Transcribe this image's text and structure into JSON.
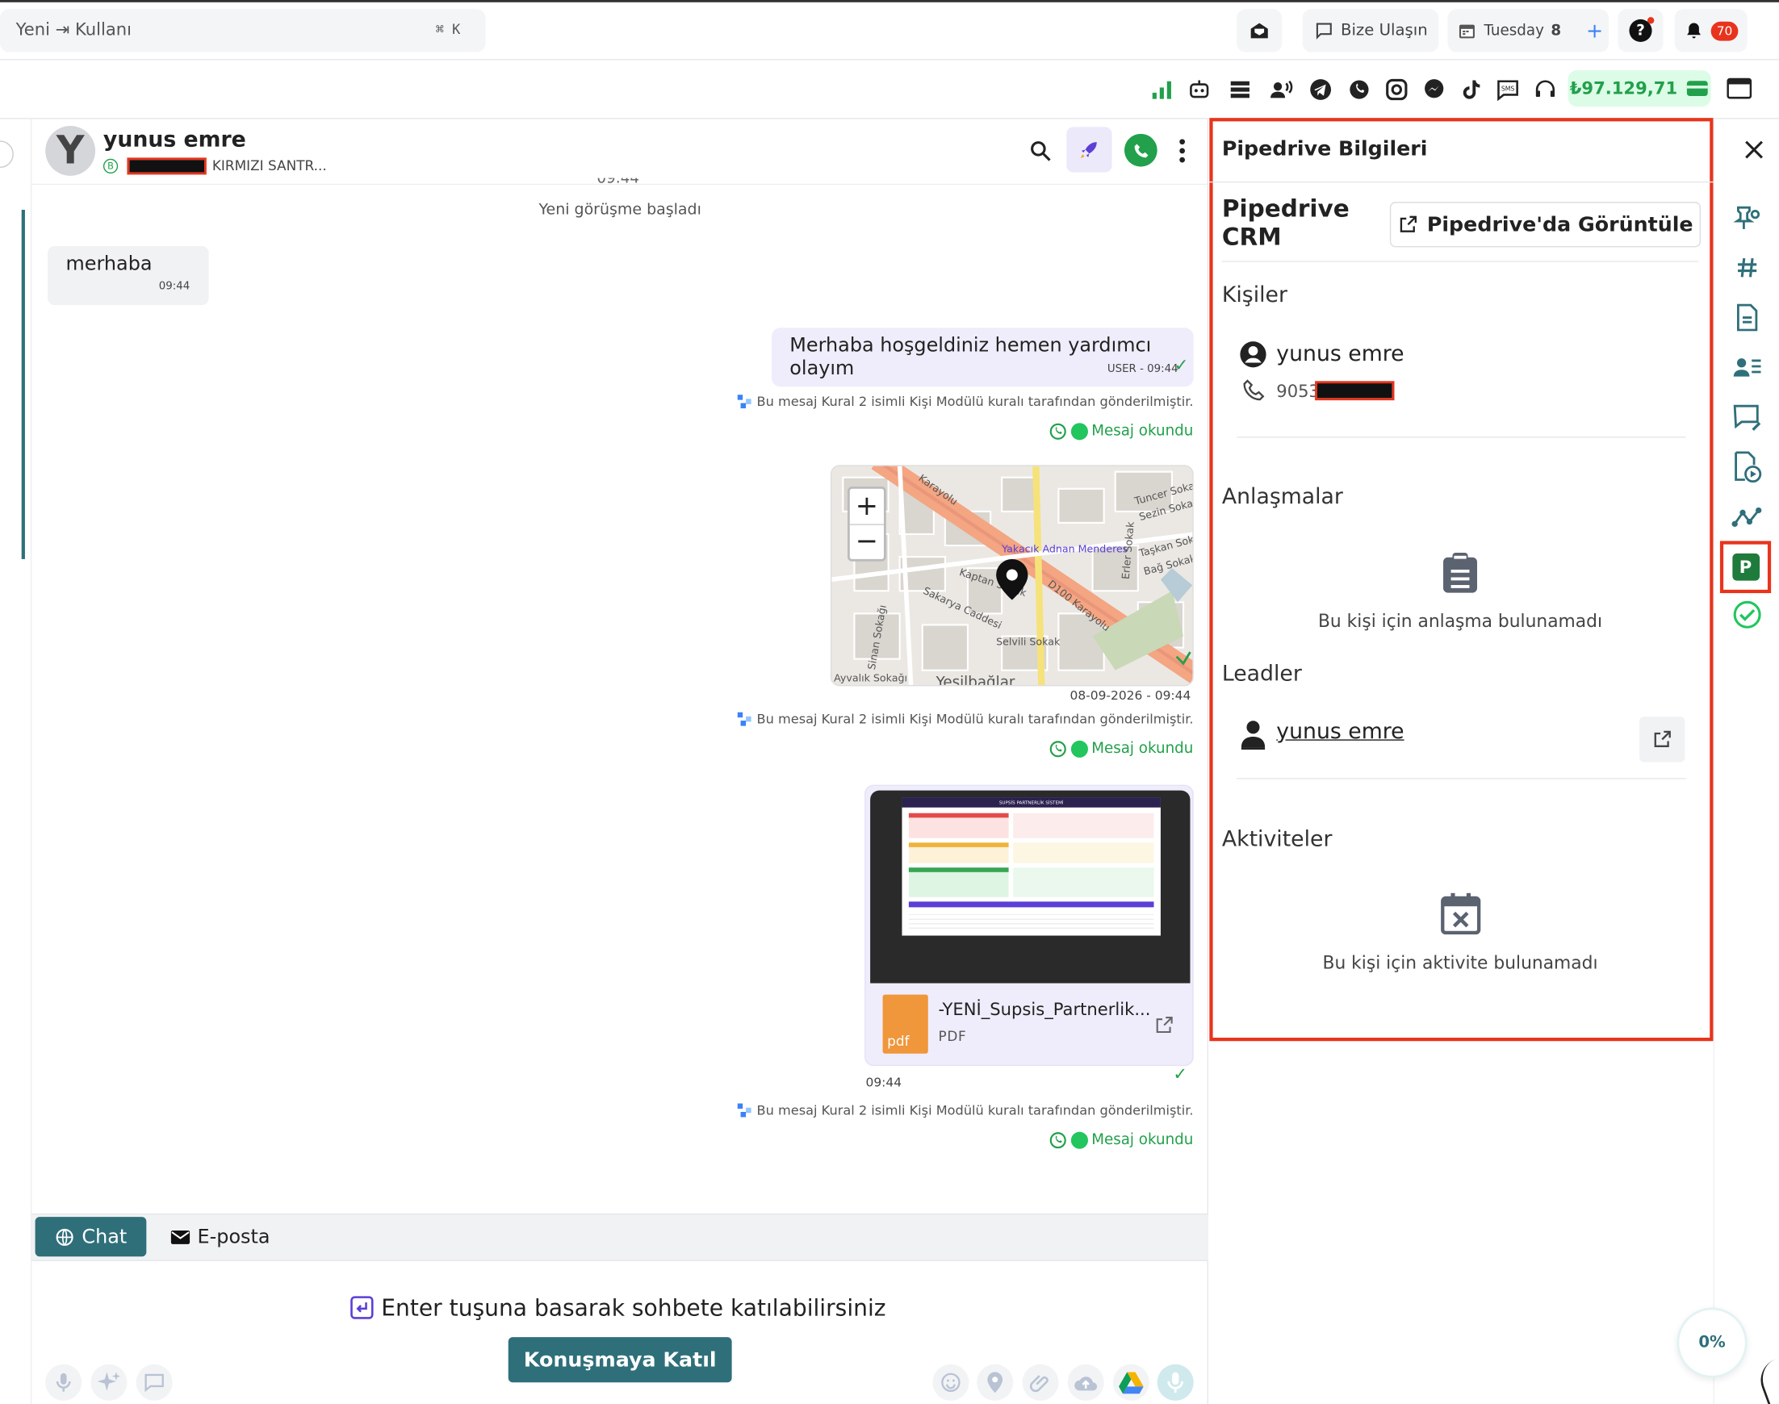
{
  "topbar": {
    "search_placeholder": "Yeni ⇥ Kullanı",
    "shortcut": "⌘ K",
    "contact_label": "Bize Ulaşın",
    "date_day": "Tuesday",
    "date_num": "8",
    "notification_count": "70"
  },
  "balance": "₺97.129,71",
  "chat": {
    "contact_name": "yunus emre",
    "contact_badge": "B",
    "contact_subtitle": "KIRMIZI SANTR...",
    "truncated_time": "09:44",
    "session_started": "Yeni görüşme başladı",
    "messages": [
      {
        "text": "merhaba",
        "time": "09:44"
      },
      {
        "text": "Merhaba hoşgeldiniz hemen yardımcı olayım",
        "meta": "USER - 09:44"
      }
    ],
    "rule_note": "Bu mesaj Kural 2 isimli Kişi Modülü kuralı tarafından gönderilmiştir.",
    "read_status": "Mesaj okundu",
    "map": {
      "timestamp": "08-09-2026 - 09:44",
      "zoom_in": "+",
      "zoom_out": "−",
      "labels": [
        "Karayolu",
        "Tuncer Sokak",
        "Sezin Sokak",
        "Yakacık Adnan Menderes",
        "Taşkan Sok",
        "Bağ Sokak",
        "Kaptan Sokak",
        "D100 Karayolu",
        "Sakarya Caddesi",
        "Selvili Sokak",
        "Sinan Sokağı",
        "Ayvalık Sokağı",
        "Yeşilbağlar",
        "Erler Sokak"
      ]
    },
    "file": {
      "name": "-YENİ_Supsis_Partnerlik...",
      "type": "PDF",
      "icon_label": "pdf",
      "time": "09:44",
      "preview_title": "SUPSİS PARTNERLİK SİSTEMİ"
    },
    "tabs": [
      {
        "label": "Chat"
      },
      {
        "label": "E-posta"
      }
    ],
    "join_hint": "Enter tuşuna basarak sohbete katılabilirsiniz",
    "join_button": "Konuşmaya Katıl",
    "progress": "0%"
  },
  "pipedrive": {
    "title": "Pipedrive Bilgileri",
    "crm_label_1": "Pipedrive",
    "crm_label_2": "CRM",
    "view_button": "Pipedrive'da Görüntüle",
    "persons_title": "Kişiler",
    "person_name": "yunus emre",
    "person_phone_prefix": "9053",
    "deals_title": "Anlaşmalar",
    "deals_empty": "Bu kişi için anlaşma bulunamadı",
    "leads_title": "Leadler",
    "lead_name": "yunus emre",
    "activities_title": "Aktiviteler",
    "activities_empty": "Bu kişi için aktivite bulunamadı"
  },
  "rail": {
    "pipedrive_letter": "P"
  },
  "colors": {
    "accent_teal": "#2f6f7a",
    "highlight_red": "#e8341c",
    "whatsapp_green": "#22a04b",
    "bubble_out": "#efedfb"
  }
}
